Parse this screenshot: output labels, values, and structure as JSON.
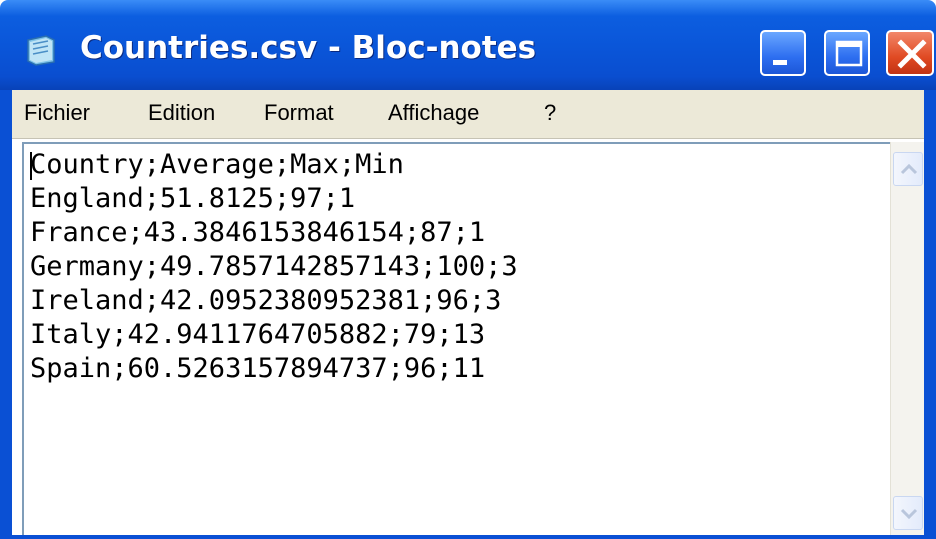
{
  "window": {
    "title": "Countries.csv - Bloc-notes",
    "accent_color": "#0a55d8",
    "close_color": "#e04a23"
  },
  "title_buttons": [
    "minimize-icon",
    "maximize-icon",
    "close-icon"
  ],
  "menu": {
    "items": [
      "Fichier",
      "Edition",
      "Format",
      "Affichage",
      "?"
    ]
  },
  "editor": {
    "lines": [
      "Country;Average;Max;Min",
      "England;51.8125;97;1",
      "France;43.3846153846154;87;1",
      "Germany;49.7857142857143;100;3",
      "Ireland;42.0952380952381;96;3",
      "Italy;42.9411764705882;79;13",
      "Spain;60.5263157894737;96;11"
    ]
  },
  "scrollbar": {
    "up_icon": "arrow-up-icon",
    "down_icon": "arrow-down-icon"
  }
}
